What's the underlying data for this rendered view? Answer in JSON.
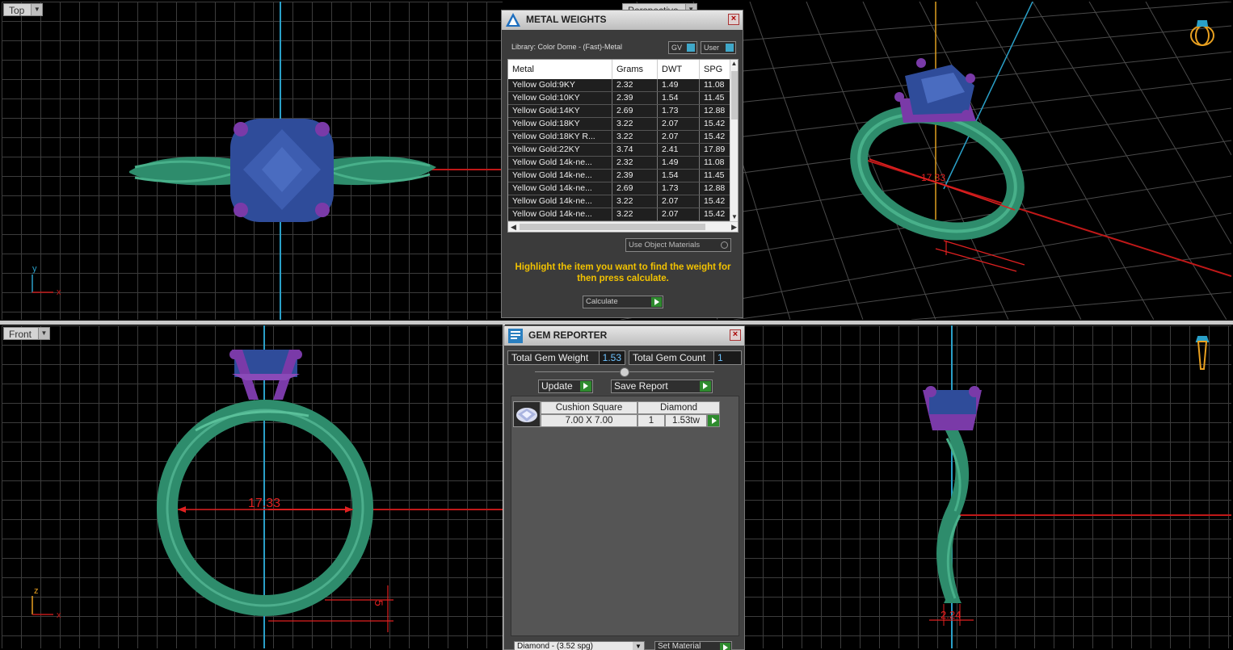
{
  "viewports": {
    "top": {
      "label": "Top",
      "axis_x": "x",
      "axis_y": "y"
    },
    "perspective": {
      "label": "Perspective",
      "dimension": "17.33"
    },
    "front": {
      "label": "Front",
      "axis_x": "x",
      "axis_z": "z",
      "dimension": "17.33",
      "dimension_small": "5"
    },
    "right": {
      "dimension": "2.24"
    }
  },
  "metal_weights": {
    "title": "METAL WEIGHTS",
    "library": "Library: Color Dome - (Fast)-Metal",
    "gv_label": "GV",
    "user_label": "User",
    "columns": [
      "Metal",
      "Grams",
      "DWT",
      "SPG"
    ],
    "rows": [
      [
        "Yellow Gold:9KY",
        "2.32",
        "1.49",
        "11.08"
      ],
      [
        "Yellow Gold:10KY",
        "2.39",
        "1.54",
        "11.45"
      ],
      [
        "Yellow Gold:14KY",
        "2.69",
        "1.73",
        "12.88"
      ],
      [
        "Yellow Gold:18KY",
        "3.22",
        "2.07",
        "15.42"
      ],
      [
        "Yellow Gold:18KY R...",
        "3.22",
        "2.07",
        "15.42"
      ],
      [
        "Yellow Gold:22KY",
        "3.74",
        "2.41",
        "17.89"
      ],
      [
        "Yellow Gold 14k-ne...",
        "2.32",
        "1.49",
        "11.08"
      ],
      [
        "Yellow Gold 14k-ne...",
        "2.39",
        "1.54",
        "11.45"
      ],
      [
        "Yellow Gold 14k-ne...",
        "2.69",
        "1.73",
        "12.88"
      ],
      [
        "Yellow Gold 14k-ne...",
        "3.22",
        "2.07",
        "15.42"
      ],
      [
        "Yellow Gold 14k-ne...",
        "3.22",
        "2.07",
        "15.42"
      ]
    ],
    "use_object_materials": "Use Object Materials",
    "hint": "Highlight the item you want to find the weight for then press calculate.",
    "calculate": "Calculate"
  },
  "gem_reporter": {
    "title": "GEM REPORTER",
    "total_weight_label": "Total Gem Weight",
    "total_weight_value": "1.53",
    "total_count_label": "Total Gem Count",
    "total_count_value": "1",
    "update": "Update",
    "save_report": "Save Report",
    "gem": {
      "shape": "Cushion Square",
      "material": "Diamond",
      "size": "7.00 X 7.00",
      "qty": "1",
      "weight": "1.53tw"
    },
    "material_select": "Diamond - (3.52 spg)",
    "set_material": "Set Material"
  },
  "colors": {
    "band": "#2e8c6c",
    "stone": "#2f4c9a",
    "prong": "#7a3aa8",
    "dimension": "#e02020",
    "axis_blue": "#2aa0c8",
    "hint": "#f2c200"
  }
}
